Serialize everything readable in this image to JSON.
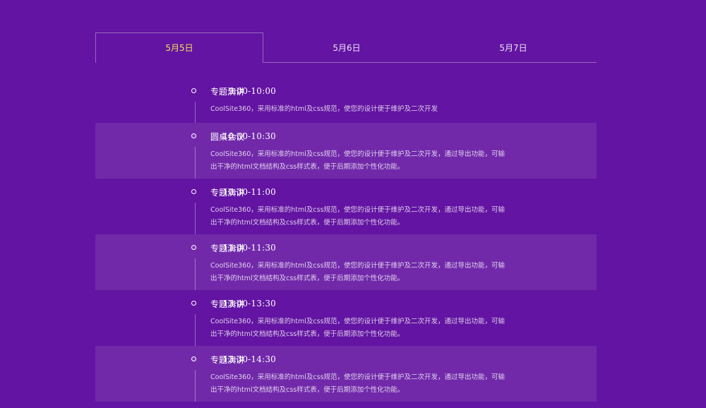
{
  "tabs": [
    {
      "label": "5月5日",
      "active": true
    },
    {
      "label": "5月6日",
      "active": false
    },
    {
      "label": "5月7日",
      "active": false
    }
  ],
  "colors": {
    "background": "#6314a2",
    "active_tab": "#f5e05a"
  },
  "schedule": [
    {
      "time": "9:00-10:00",
      "title": "专题演讲",
      "description": "CoolSite360，采用标准的html及css规范，使您的设计便于维护及二次开发"
    },
    {
      "time": "10:00-10:30",
      "title": "圆桌会议",
      "description": "CoolSite360，采用标准的html及css规范，使您的设计便于维护及二次开发，通过导出功能，可输出干净的html文档结构及css样式表，便于后期添加个性化功能。"
    },
    {
      "time": "10:30-11:00",
      "title": "专题演讲",
      "description": "CoolSite360，采用标准的html及css规范，使您的设计便于维护及二次开发，通过导出功能，可输出干净的html文档结构及css样式表，便于后期添加个性化功能。"
    },
    {
      "time": "11:00-11:30",
      "title": "专题演讲",
      "description": "CoolSite360，采用标准的html及css规范，使您的设计便于维护及二次开发，通过导出功能，可输出干净的html文档结构及css样式表，便于后期添加个性化功能。"
    },
    {
      "time": "13:00-13:30",
      "title": "专题演讲",
      "description": "CoolSite360，采用标准的html及css规范，使您的设计便于维护及二次开发，通过导出功能，可输出干净的html文档结构及css样式表，便于后期添加个性化功能。"
    },
    {
      "time": "13:30-14:30",
      "title": "专题演讲",
      "description": "CoolSite360，采用标准的html及css规范，使您的设计便于维护及二次开发，通过导出功能，可输出干净的html文档结构及css样式表，便于后期添加个性化功能。"
    }
  ]
}
